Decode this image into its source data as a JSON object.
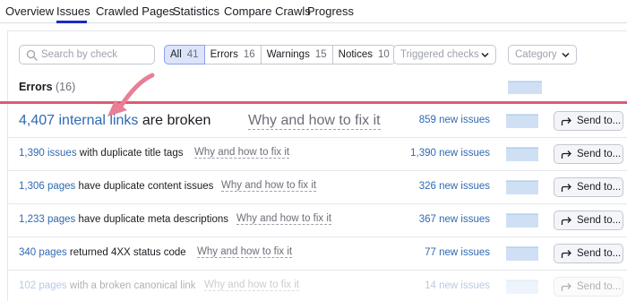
{
  "nav": {
    "tabs": [
      {
        "label": "Overview"
      },
      {
        "label": "Issues"
      },
      {
        "label": "Crawled Pages"
      },
      {
        "label": "Statistics"
      },
      {
        "label": "Compare Crawls"
      },
      {
        "label": "Progress"
      }
    ],
    "active_tab": "Issues"
  },
  "filters": {
    "search_placeholder": "Search by check",
    "segments": [
      {
        "label": "All",
        "count": "41",
        "active": true
      },
      {
        "label": "Errors",
        "count": "16",
        "active": false
      },
      {
        "label": "Warnings",
        "count": "15",
        "active": false
      },
      {
        "label": "Notices",
        "count": "10",
        "active": false
      }
    ],
    "triggered_checks": "Triggered checks",
    "category": "Category"
  },
  "errors": {
    "title": "Errors",
    "count": "(16)"
  },
  "rows": [
    {
      "link": "4,407 internal links",
      "rest": " are broken",
      "fix": "Why and how to fix it",
      "new_issues": "859 new issues",
      "send": "Send to..."
    },
    {
      "link": "1,390 issues",
      "rest": " with duplicate title tags",
      "fix": "Why and how to fix it",
      "new_issues": "1,390 new issues",
      "send": "Send to..."
    },
    {
      "link": "1,306 pages",
      "rest": " have duplicate content issues",
      "fix": "Why and how to fix it",
      "new_issues": "326 new issues",
      "send": "Send to..."
    },
    {
      "link": "1,233 pages",
      "rest": " have duplicate meta descriptions",
      "fix": "Why and how to fix it",
      "new_issues": "367 new issues",
      "send": "Send to..."
    },
    {
      "link": "340 pages",
      "rest": " returned 4XX status code",
      "fix": "Why and how to fix it",
      "new_issues": "77 new issues",
      "send": "Send to..."
    },
    {
      "link": "102 pages",
      "rest": " with a broken canonical link",
      "fix": "Why and how to fix it",
      "new_issues": "14 new issues",
      "send": "Send to..."
    }
  ],
  "colors": {
    "accent": "#2f6ab3",
    "highlight": "#df5b6e",
    "active_segment": "#dce4fb",
    "sparkline": "#cfe0f4"
  },
  "icons": {
    "search": "search-icon",
    "chevron": "chevron-down-icon",
    "share": "share-forward-icon",
    "arrow": "pointer-arrow-icon"
  }
}
